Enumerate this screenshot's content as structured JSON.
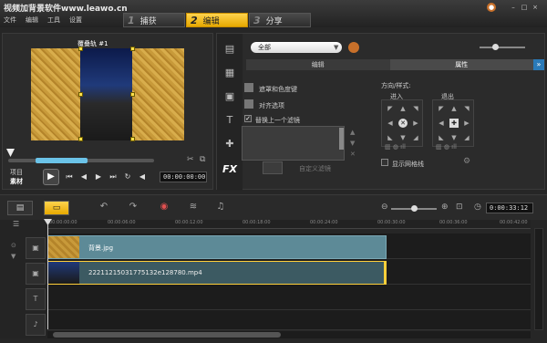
{
  "app": {
    "title": "视频加背景软件www.leawo.cn"
  },
  "menu": [
    "文件",
    "编辑",
    "工具",
    "设置"
  ],
  "steps": [
    {
      "num": "1",
      "label": "捕获"
    },
    {
      "num": "2",
      "label": "编辑"
    },
    {
      "num": "3",
      "label": "分享"
    }
  ],
  "preview": {
    "clip_label": "覆叠轨 #1",
    "project_label": "项目",
    "clip_mode_label": "素材",
    "timecode": "00:00:00:00"
  },
  "options": {
    "dropdown_value": "全部",
    "tabs": [
      "编辑",
      "属性"
    ],
    "mask_label": "遮罩和色度键",
    "align_label": "对齐选项",
    "replace_label": "替换上一个滤镜",
    "custom_filter_label": "自定义滤镜",
    "direction_label": "方向/样式:",
    "enter_label": "进入",
    "exit_label": "退出",
    "grid_label": "显示网格线",
    "fx_label": "FX"
  },
  "timeline": {
    "timecode": "0:00:33:12",
    "ruler": [
      "00:00:00:00",
      "00:00:06:00",
      "00:00:12:00",
      "00:00:18:00",
      "00:00:24:00",
      "00:00:30:00",
      "00:00:36:00",
      "00:00:42:00"
    ],
    "tracks": [
      {
        "name": "背景.jpg"
      },
      {
        "name": "22211215031775132e128780.mp4"
      }
    ]
  },
  "colors": {
    "accent": "#f2b81c",
    "clip_bg": "#5d8a97",
    "clip_video": "#3c5a62",
    "selection": "#6bc3e8"
  }
}
